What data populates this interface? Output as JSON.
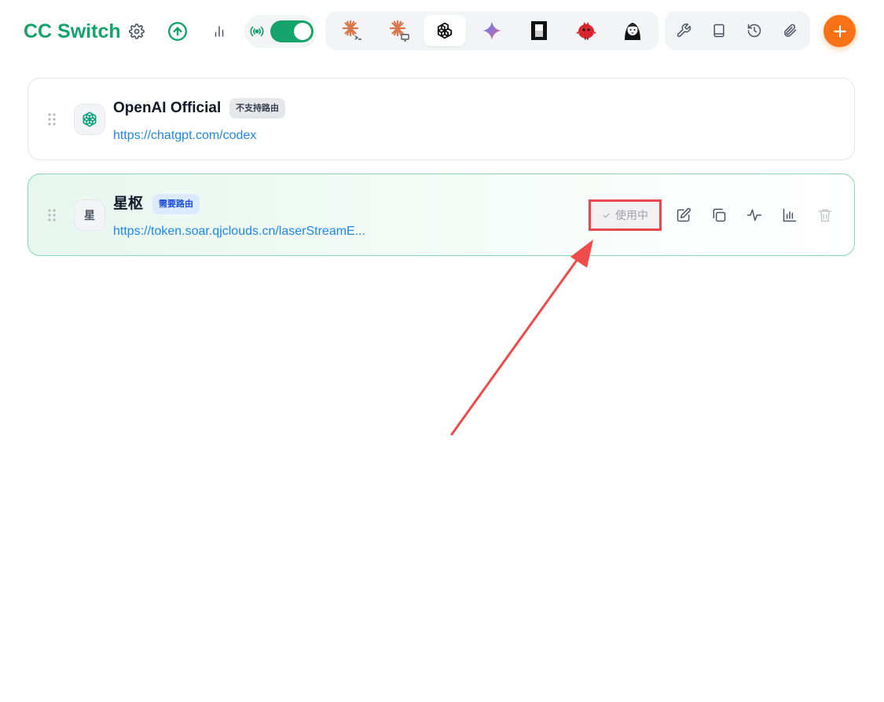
{
  "header": {
    "app_title": "CC Switch",
    "buttons": {
      "settings": "gear-icon",
      "update": "arrow-up-circle-icon",
      "usage": "bar-chart-icon",
      "proxy": "broadcast-icon"
    },
    "proxy_toggle": {
      "on": true
    },
    "app_tabs": [
      {
        "name": "claude-code",
        "icon": "claude-asterisk-icon",
        "active": false
      },
      {
        "name": "claude-desktop",
        "icon": "claude-desktop-icon",
        "active": false
      },
      {
        "name": "codex",
        "icon": "openai-icon",
        "active": true
      },
      {
        "name": "gemini",
        "icon": "gemini-sparkle-icon",
        "active": false
      },
      {
        "name": "opencode",
        "icon": "opencode-icon",
        "active": false
      },
      {
        "name": "red-bird",
        "icon": "red-bird-icon",
        "active": false
      },
      {
        "name": "character",
        "icon": "character-icon",
        "active": false
      }
    ],
    "tools": [
      "wrench-icon",
      "book-icon",
      "history-icon",
      "paperclip-icon"
    ],
    "add_button": "plus-icon"
  },
  "colors": {
    "brand": "#16a36b",
    "accent_orange": "#f97316",
    "link": "#1e88e5",
    "highlight_red": "#e5484d"
  },
  "providers": [
    {
      "name": "OpenAI Official",
      "badge": "不支持路由",
      "url": "https://chatgpt.com/codex",
      "avatar_icon": "openai-icon",
      "active": false
    },
    {
      "name": "星枢",
      "badge": "需要路由",
      "url": "https://token.soar.qjclouds.cn/laserStreamE...",
      "avatar_text": "星",
      "active": true,
      "status_label": "使用中",
      "actions": [
        "edit-icon",
        "copy-icon",
        "pulse-icon",
        "bar-chart-icon",
        "trash-icon"
      ]
    }
  ]
}
